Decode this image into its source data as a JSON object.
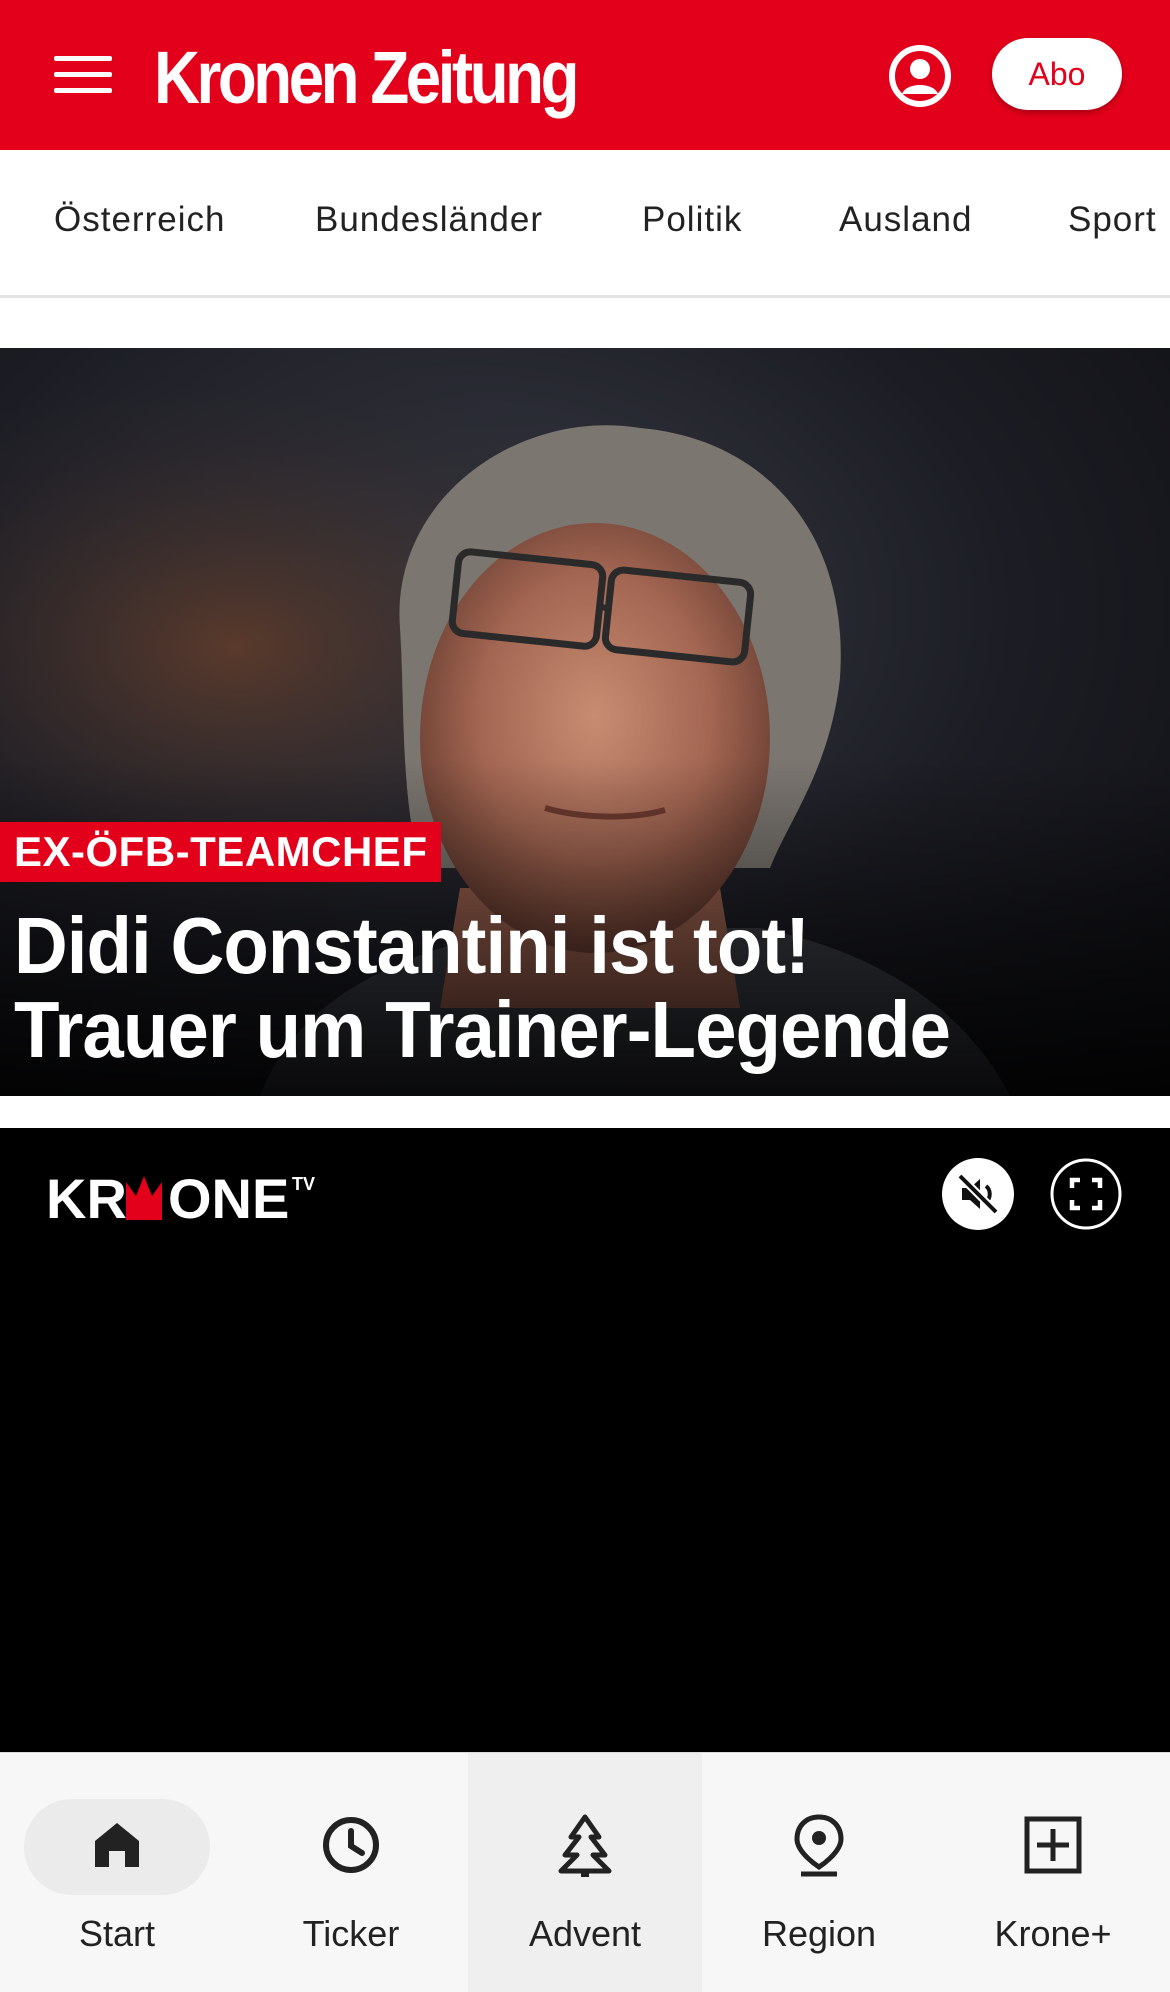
{
  "header": {
    "logo_text": "Kronen Zeitung",
    "abo_label": "Abo",
    "brand_color": "#e2001a"
  },
  "nav": {
    "items": [
      "Österreich",
      "Bundesländer",
      "Politik",
      "Ausland",
      "Sport"
    ]
  },
  "hero": {
    "kicker": "EX-ÖFB-TEAMCHEF",
    "headline_line1": "Didi Constantini ist tot!",
    "headline_line2": "Trauer um Trainer-Legende"
  },
  "video": {
    "logo_text": "KRONE TV",
    "icons": [
      "mute-icon",
      "fullscreen-icon"
    ]
  },
  "bottom_nav": {
    "tabs": [
      {
        "label": "Start",
        "icon": "home-icon"
      },
      {
        "label": "Ticker",
        "icon": "clock-icon"
      },
      {
        "label": "Advent",
        "icon": "tree-icon"
      },
      {
        "label": "Region",
        "icon": "location-icon"
      },
      {
        "label": "Krone+",
        "icon": "plus-box-icon"
      }
    ]
  }
}
